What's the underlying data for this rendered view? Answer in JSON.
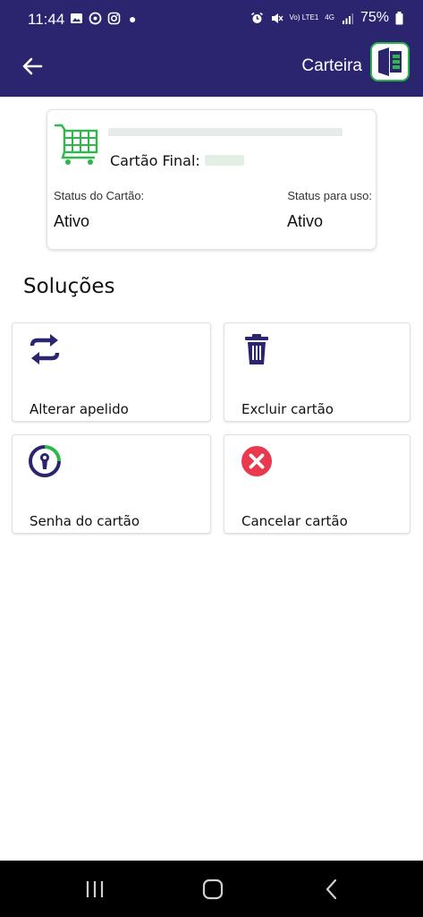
{
  "status_bar": {
    "time": "11:44",
    "network": "Vo) LTE1",
    "network_type": "4G",
    "battery": "75%",
    "icons": [
      "gallery-icon",
      "whatsapp-icon",
      "instagram-icon",
      "notification-dot",
      "alarm-icon",
      "mute-icon",
      "signal-icon",
      "battery-icon"
    ]
  },
  "app_bar": {
    "back_icon": "arrow-left-icon",
    "title": "Carteira",
    "logo_icon": "wallet-logo-icon"
  },
  "card": {
    "icon": "shopping-cart-icon",
    "final_label": "Cartão Final:",
    "status_card_label": "Status do Cartão:",
    "status_card_value": "Ativo",
    "status_use_label": "Status para uso:",
    "status_use_value": "Ativo"
  },
  "solutions": {
    "title": "Soluções",
    "items": [
      {
        "label": "Alterar apelido",
        "icon": "swap-arrows-icon"
      },
      {
        "label": "Excluir cartão",
        "icon": "trash-icon"
      },
      {
        "label": "Senha do cartão",
        "icon": "keyhole-icon"
      },
      {
        "label": "Cancelar cartão",
        "icon": "cancel-x-icon"
      }
    ]
  },
  "nav_bar": {
    "icons": [
      "recent-apps-icon",
      "home-icon",
      "back-icon"
    ]
  },
  "colors": {
    "primary": "#2b2570",
    "accent_green": "#25b34a",
    "danger": "#e8394e",
    "background": "#ffffff"
  }
}
